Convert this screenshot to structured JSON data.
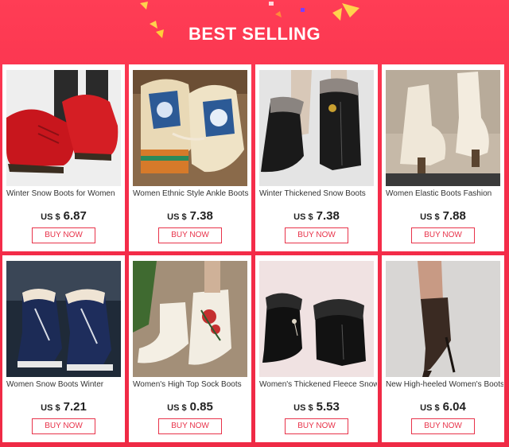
{
  "header": {
    "title": "BEST SELLING"
  },
  "colors": {
    "accent": "#e8334a",
    "background": "#f52d4a"
  },
  "products": [
    {
      "name": "Winter Snow Boots for Women",
      "currency": "US $",
      "price": "6.87",
      "button": "BUY NOW",
      "image": "red-leather-ankle-boot"
    },
    {
      "name": "Women Ethnic Style Ankle Boots",
      "currency": "US $",
      "price": "7.38",
      "button": "BUY NOW",
      "image": "ethnic-embroidered-boot"
    },
    {
      "name": "Winter Thickened Snow Boots",
      "currency": "US $",
      "price": "7.38",
      "button": "BUY NOW",
      "image": "black-fur-snow-boot"
    },
    {
      "name": "Women Elastic Boots Fashion",
      "currency": "US $",
      "price": "7.88",
      "button": "BUY NOW",
      "image": "white-sock-boot"
    },
    {
      "name": "Women Snow Boots Winter",
      "currency": "US $",
      "price": "7.21",
      "button": "BUY NOW",
      "image": "navy-lace-up-snow-boot"
    },
    {
      "name": "Women's High Top Sock Boots",
      "currency": "US $",
      "price": "0.85",
      "button": "BUY NOW",
      "image": "white-floral-sock-boot"
    },
    {
      "name": "Women's Thickened Fleece Snow",
      "currency": "US $",
      "price": "5.53",
      "button": "BUY NOW",
      "image": "black-fur-cuff-boot"
    },
    {
      "name": "New High-heeled Women's Boots",
      "currency": "US $",
      "price": "6.04",
      "button": "BUY NOW",
      "image": "brown-stiletto-sock-boot"
    }
  ]
}
